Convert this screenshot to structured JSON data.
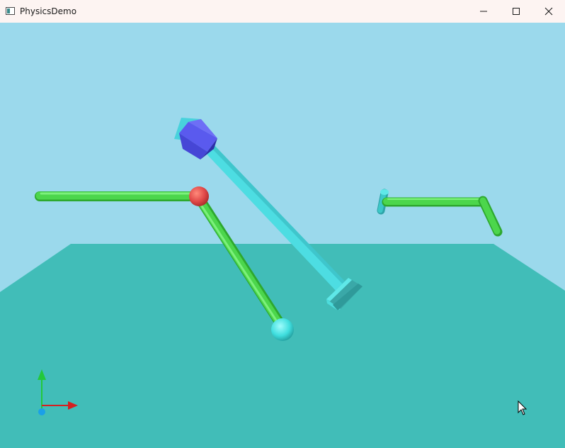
{
  "window": {
    "title": "PhysicsDemo",
    "controls": {
      "minimize_icon": "minimize-icon",
      "maximize_icon": "maximize-icon",
      "close_icon": "close-icon"
    }
  },
  "scene": {
    "sky_color": "#9bd9ec",
    "ground_color": "#41bdb8",
    "objects": [
      {
        "name": "green-horizontal-rod",
        "color": "#4cd64c"
      },
      {
        "name": "red-sphere-joint",
        "color": "#e84c4c"
      },
      {
        "name": "green-hanging-rod",
        "color": "#4cd64c"
      },
      {
        "name": "cyan-sphere",
        "color": "#43dede"
      },
      {
        "name": "blue-cube",
        "color": "#4b4be0"
      },
      {
        "name": "cyan-diagonal-beam",
        "color": "#43d8dc"
      },
      {
        "name": "cyan-end-block",
        "color": "#3fc6c6"
      },
      {
        "name": "cyan-short-cylinder",
        "color": "#3cc8c8"
      },
      {
        "name": "green-bent-rod",
        "color": "#4cd64c"
      }
    ],
    "axes_gizmo": {
      "x_color": "#d42020",
      "y_color": "#22c83a",
      "z_color": "#1aa0e8"
    }
  }
}
